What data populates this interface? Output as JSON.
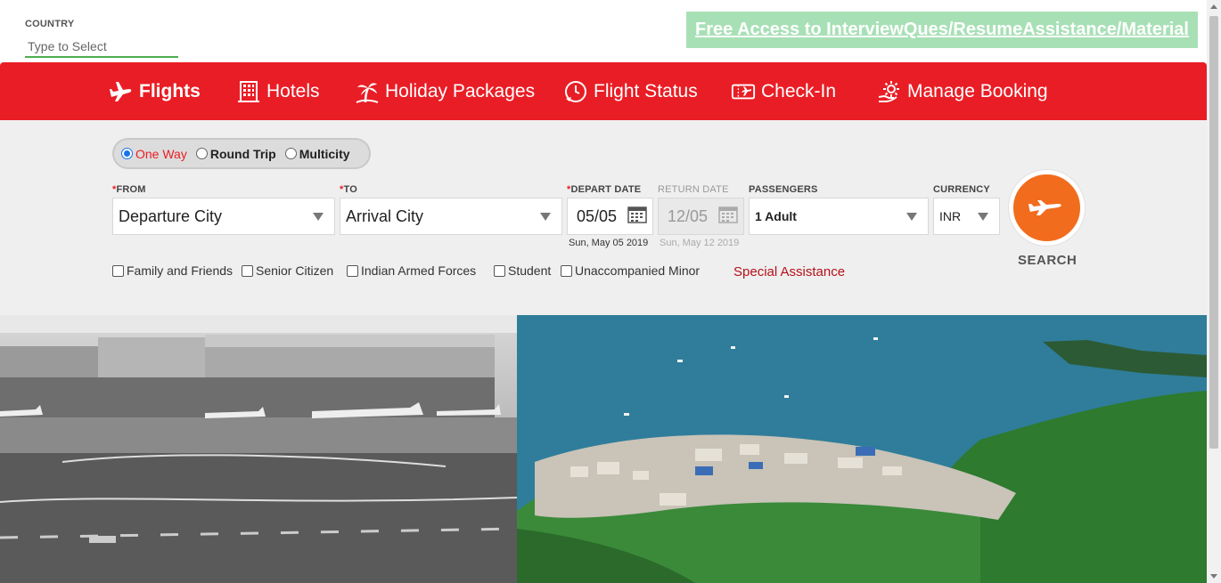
{
  "country": {
    "label": "COUNTRY",
    "placeholder": "Type to Select"
  },
  "promo": {
    "text": "Free Access to InterviewQues/ResumeAssistance/Material"
  },
  "nav": {
    "items": [
      {
        "label": "Flights",
        "icon": "plane-icon"
      },
      {
        "label": "Hotels",
        "icon": "building-icon"
      },
      {
        "label": "Holiday Packages",
        "icon": "palm-tree-icon"
      },
      {
        "label": "Flight Status",
        "icon": "clock-plane-icon"
      },
      {
        "label": "Check-In",
        "icon": "ticket-plane-icon"
      },
      {
        "label": "Manage Booking",
        "icon": "gear-hand-icon"
      }
    ]
  },
  "trip": {
    "options": [
      "One Way",
      "Round Trip",
      "Multicity"
    ],
    "selected": "One Way"
  },
  "form": {
    "from_label": "FROM",
    "from_value": "Departure City",
    "to_label": "TO",
    "to_value": "Arrival City",
    "depart_label": "DEPART DATE",
    "depart_value": "05/05",
    "depart_sub": "Sun, May 05 2019",
    "return_label": "RETURN DATE",
    "return_value": "12/05",
    "return_sub": "Sun, May 12 2019",
    "passengers_label": "PASSENGERS",
    "passengers_value": "1 Adult",
    "currency_label": "CURRENCY",
    "currency_value": "INR",
    "required_mark": "*"
  },
  "checkboxes": [
    "Family and Friends",
    "Senior Citizen",
    "Indian Armed Forces",
    "Student",
    "Unaccompanied Minor"
  ],
  "special_assistance": "Special Assistance",
  "search": {
    "label": "SEARCH"
  },
  "colors": {
    "brand_red": "#e91d25",
    "search_orange": "#f26c1d",
    "promo_green": "#a8e0b6"
  }
}
